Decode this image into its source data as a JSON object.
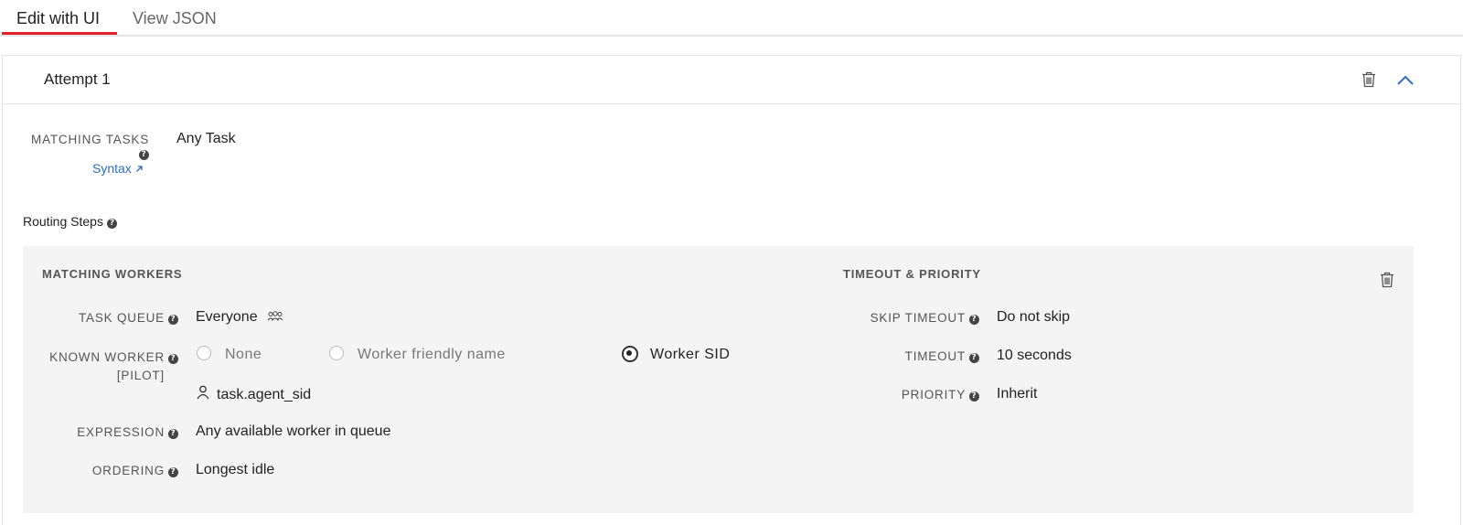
{
  "tabs": [
    {
      "label": "Edit with UI"
    },
    {
      "label": "View JSON"
    }
  ],
  "attempt": {
    "title": "Attempt 1",
    "matching_tasks_label": "MATCHING TASKS",
    "matching_tasks_value": "Any Task",
    "syntax_link": "Syntax",
    "routing_steps_label": "Routing Steps"
  },
  "matching_workers": {
    "heading": "MATCHING WORKERS",
    "task_queue_label": "TASK QUEUE",
    "task_queue_value": "Everyone",
    "known_worker_label_1": "KNOWN WORKER",
    "known_worker_label_2": "[PILOT]",
    "options": [
      {
        "label": "None",
        "checked": false
      },
      {
        "label": "Worker friendly name",
        "checked": false
      },
      {
        "label": "Worker SID",
        "checked": true
      }
    ],
    "worker_sid_value": "task.agent_sid",
    "expression_label": "EXPRESSION",
    "expression_value": "Any available worker in queue",
    "ordering_label": "ORDERING",
    "ordering_value": "Longest idle"
  },
  "timeout_priority": {
    "heading": "TIMEOUT & PRIORITY",
    "skip_timeout_label": "SKIP TIMEOUT",
    "skip_timeout_value": "Do not skip",
    "timeout_label": "TIMEOUT",
    "timeout_value": "10 seconds",
    "priority_label": "PRIORITY",
    "priority_value": "Inherit"
  },
  "colors": {
    "accent_red": "#e3202f",
    "link_blue": "#2f6fc2",
    "panel_bg": "#f4f4f4"
  },
  "icons": [
    "trash-icon",
    "chevron-up-icon",
    "help-icon",
    "external-link-icon",
    "queue-group-icon",
    "person-icon"
  ]
}
